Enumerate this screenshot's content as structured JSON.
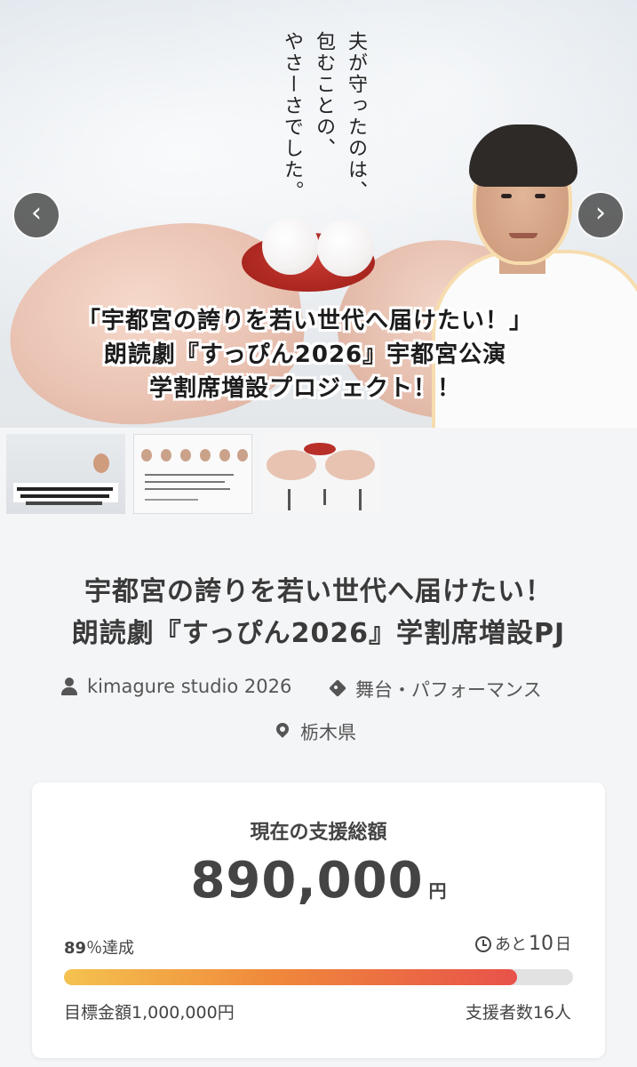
{
  "hero": {
    "vertical_text": [
      "夫が守ったのは、",
      "包むことの、",
      "やさーさでした。"
    ],
    "headline": [
      "「宇都宮の誇りを若い世代へ届けたい！」",
      "朗読劇『すっぴん2026』宇都宮公演",
      "学割席増設プロジェクト！！"
    ],
    "prev_icon": "‹",
    "next_icon": "›",
    "thumbnail_count": 3
  },
  "project": {
    "title_line1": "宇都宮の誇りを若い世代へ届けたい！",
    "title_line2": "朗読劇『すっぴん2026』学割席増設PJ",
    "creator": "kimagure studio 2026",
    "category": "舞台・パフォーマンス",
    "location": "栃木県"
  },
  "funding": {
    "label": "現在の支援総額",
    "amount": "890,000",
    "unit": "円",
    "percent": "89",
    "percent_suffix": "％達成",
    "progress": 0.89,
    "remaining_prefix": "あと",
    "remaining_num": "10",
    "remaining_unit": "日",
    "goal": "目標金額1,000,000円",
    "backers": "支援者数16人"
  },
  "colors": {
    "progress_start": "#f4c24f",
    "progress_end": "#e8524a",
    "track": "#e2e2e2",
    "plate_red": "#b82f29"
  },
  "icons": [
    "chevron-left-icon",
    "chevron-right-icon",
    "person-icon",
    "tag-icon",
    "location-pin-icon",
    "clock-icon"
  ]
}
